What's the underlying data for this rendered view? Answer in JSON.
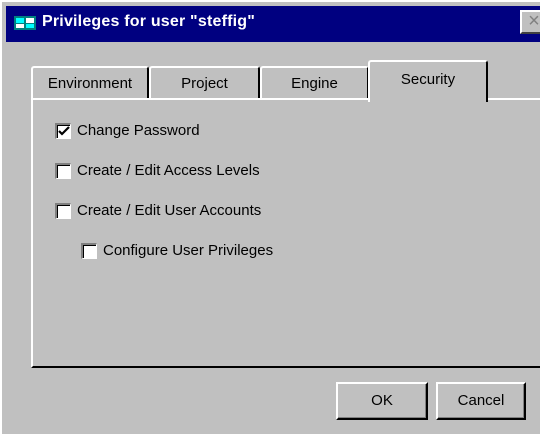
{
  "window": {
    "title": "Privileges for user \"steffig\"",
    "close_glyph": "×"
  },
  "tabs": [
    {
      "label": "Environment",
      "active": false
    },
    {
      "label": "Project",
      "active": false
    },
    {
      "label": "Engine",
      "active": false
    },
    {
      "label": "Security",
      "active": true
    }
  ],
  "security": {
    "options": [
      {
        "label": "Change Password",
        "checked": true
      },
      {
        "label": "Create / Edit Access Levels",
        "checked": false
      },
      {
        "label": "Create / Edit User Accounts",
        "checked": false
      },
      {
        "label": "Configure User Privileges",
        "checked": false
      }
    ]
  },
  "buttons": {
    "ok_label": "OK",
    "cancel_label": "Cancel"
  },
  "colors": {
    "title_bar": "#000080",
    "dialog_face": "#c0c0c0"
  }
}
